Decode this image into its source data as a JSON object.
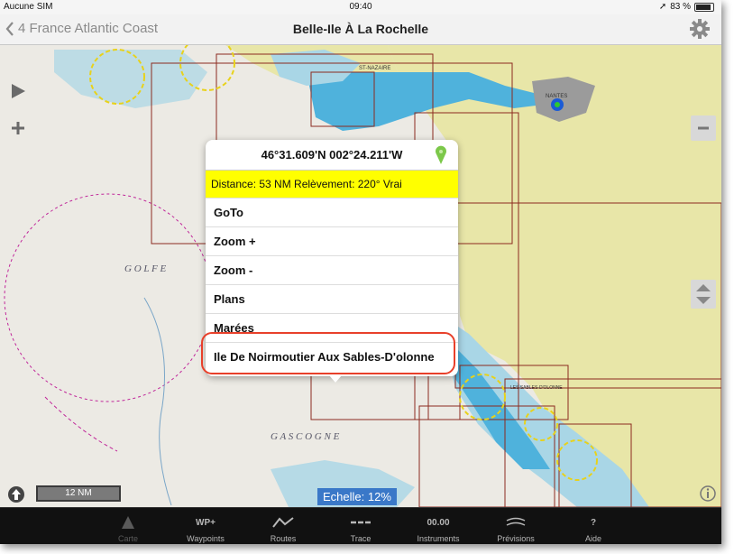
{
  "status_bar": {
    "carrier": "Aucune SIM",
    "time": "09:40",
    "battery": "83 %"
  },
  "nav": {
    "back_label": "4 France Atlantic Coast",
    "title": "Belle-Ile À La Rochelle"
  },
  "map": {
    "labels": {
      "golfe": "G O L F E",
      "gascogne": "G A S C O G N E",
      "nantes": "NANTES",
      "st_nazaire": "ST-NAZAIRE",
      "les_sables": "LES SABLES-D'OLONNE"
    },
    "scale_bar": "12 NM",
    "scale_label": "Echelle: 12%",
    "colors": {
      "land": "#e8e6a8",
      "sea_deep": "#eceae4",
      "sea_shallow": "#a9d6e6",
      "water_blue": "#4fb2dc",
      "chart_outline": "#8b2b1f",
      "magenta": "#c0279a"
    }
  },
  "popup": {
    "coords": "46°31.609'N 002°24.211'W",
    "distance": "Distance: 53 NM  Relèvement: 220° Vrai",
    "items": [
      "GoTo",
      "Zoom +",
      "Zoom -",
      "Plans",
      "Marées",
      "Ile De Noirmoutier Aux Sables-D'olonne"
    ]
  },
  "tabs": [
    {
      "icon": "chart-icon",
      "label": "Carte"
    },
    {
      "icon": "wp-icon",
      "icon_text": "WP+",
      "label": "Waypoints"
    },
    {
      "icon": "routes-icon",
      "label": "Routes"
    },
    {
      "icon": "trace-icon",
      "label": "Trace"
    },
    {
      "icon": "instruments-icon",
      "icon_text": "00.00",
      "label": "Instruments"
    },
    {
      "icon": "forecast-icon",
      "label": "Prévisions"
    },
    {
      "icon": "help-icon",
      "icon_text": "?",
      "label": "Aide"
    }
  ]
}
